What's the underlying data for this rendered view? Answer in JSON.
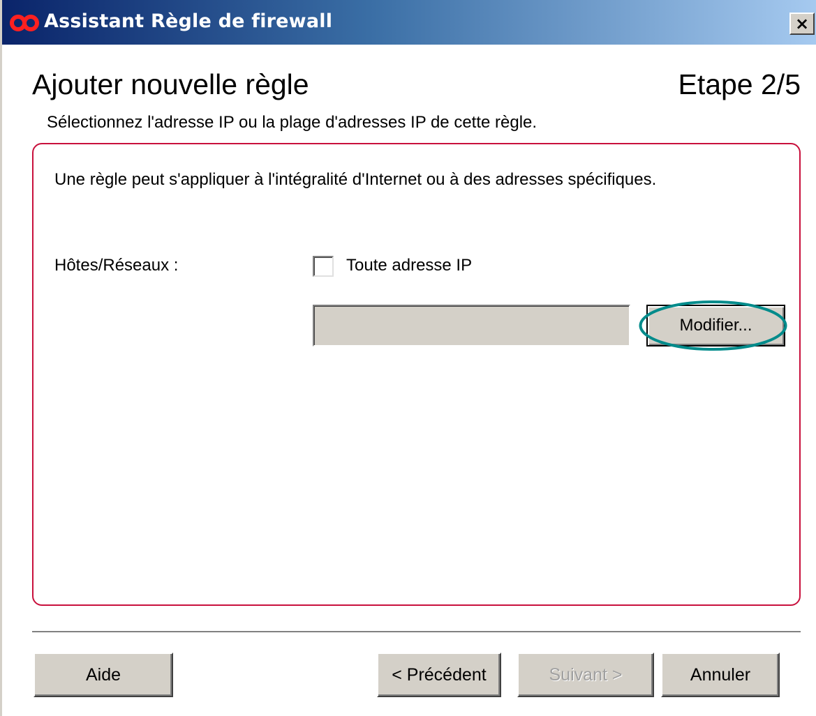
{
  "window": {
    "title": "Assistant Règle de firewall",
    "app_icon": "infinity-logo-icon",
    "close_icon": "close-icon",
    "close_label": "×",
    "accent_color": "#c8103c",
    "titlebar_color": "#0a246a"
  },
  "header": {
    "title": "Ajouter nouvelle règle",
    "step": "Etape 2/5",
    "subtitle": "Sélectionnez l'adresse IP ou la plage d'adresses IP de cette règle."
  },
  "panel": {
    "description": "Une règle peut s'appliquer à l'intégralité d'Internet ou à des adresses spécifiques.",
    "hosts_label": "Hôtes/Réseaux :",
    "any_ip_checkbox": {
      "label": "Toute adresse IP",
      "checked": false
    },
    "ip_field": {
      "value": ""
    },
    "modify_button": "Modifier...",
    "highlight_color": "#008b8b"
  },
  "footer": {
    "help_button": "Aide",
    "previous_button": "< Précédent",
    "next_button": "Suivant >",
    "next_disabled": true,
    "cancel_button": "Annuler"
  }
}
